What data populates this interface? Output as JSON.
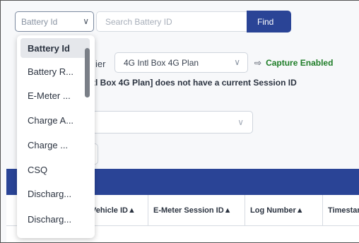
{
  "search_bar": {
    "selected_field": "Battery Id",
    "search_placeholder": "Search Battery ID",
    "find_label": "Find"
  },
  "filters": {
    "tier_label_partial": "ier",
    "plan_value": "4G Intl Box 4G Plan",
    "capture_status": "Capture Enabled",
    "warning": "tl Box 4G Plan] does not have a current Session ID"
  },
  "dropdown": {
    "options": [
      "Battery Id",
      "Battery R...",
      "E-Meter ...",
      "Charge A...",
      "Charge ...",
      "CSQ",
      "Discharg...",
      "Discharg..."
    ]
  },
  "table": {
    "columns": [
      "Vehicle ID▲",
      "E-Meter Session ID▲",
      "Log Number▲",
      "Timestamp"
    ]
  },
  "colors": {
    "primary": "#2a4496",
    "success": "#1e7d27"
  }
}
